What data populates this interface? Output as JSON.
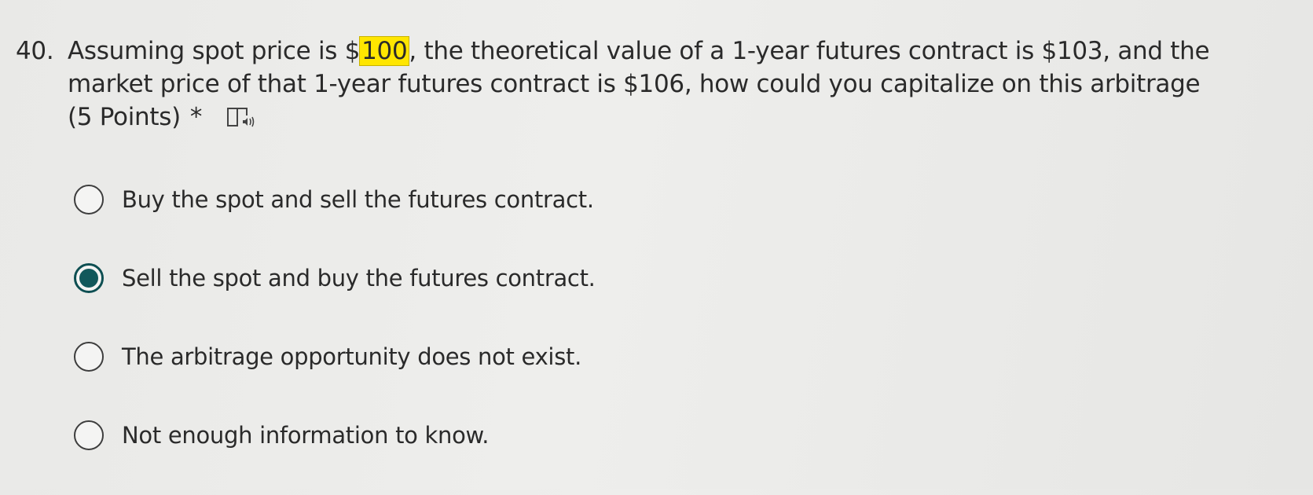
{
  "question": {
    "number": "40.",
    "line1_before": "Assuming spot price is ",
    "line1_highlight_partial": "$",
    "line1_highlight": "100",
    "line1_after": ", the theoretical value of a 1-year futures contract is $103, and the",
    "line2": "market price of that 1-year futures contract is $106, how could you capitalize on this arbitrage",
    "points": "(5 Points)",
    "required_mark": "*",
    "immersive_reader_icon": "immersive-reader-icon"
  },
  "options": [
    {
      "label": "Buy the spot and sell the futures contract.",
      "selected": false
    },
    {
      "label": "Sell the spot and buy the futures contract.",
      "selected": true
    },
    {
      "label": "The arbitrage opportunity does not exist.",
      "selected": false
    },
    {
      "label": "Not enough information to know.",
      "selected": false
    }
  ],
  "colors": {
    "highlight": "#ffe600",
    "selected_radio": "#12585b",
    "background": "#ebebe9",
    "text": "#2a2a2a"
  }
}
